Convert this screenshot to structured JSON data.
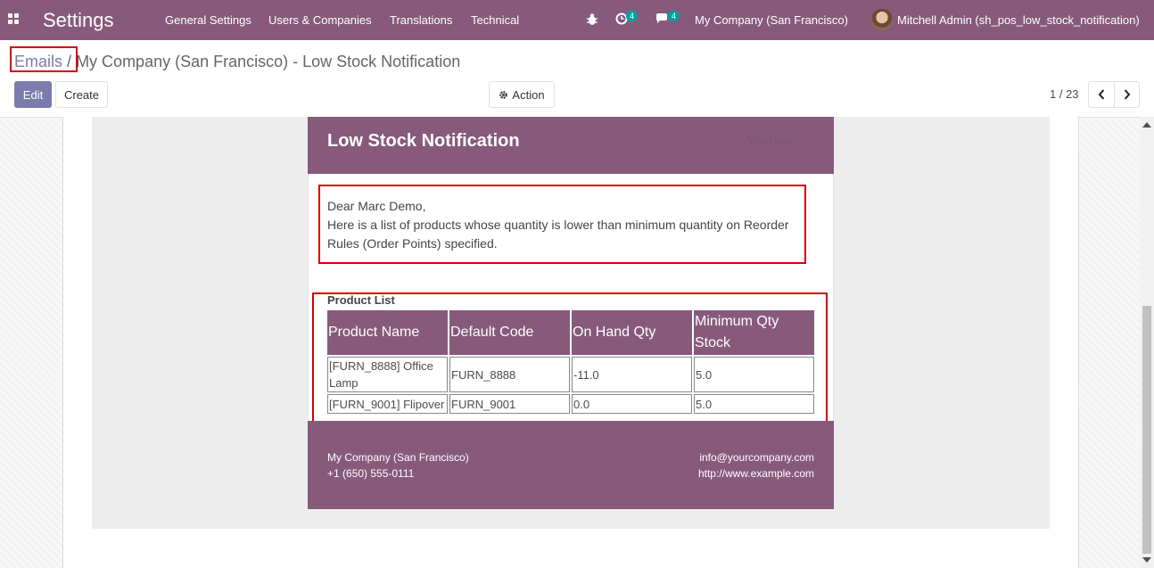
{
  "navbar": {
    "app_title": "Settings",
    "menu": [
      "General Settings",
      "Users & Companies",
      "Translations",
      "Technical"
    ],
    "activity_count": "4",
    "messages_count": "4",
    "company": "My Company (San Francisco)",
    "user": "Mitchell Admin (sh_pos_low_stock_notification)",
    "brand_color": "#875a7b"
  },
  "breadcrumb": {
    "parent": "Emails",
    "separator": "/",
    "current": "My Company (San Francisco) - Low Stock Notification"
  },
  "toolbar": {
    "edit_label": "Edit",
    "create_label": "Create",
    "action_label": "Action",
    "pager": "1 / 23"
  },
  "email": {
    "title": "Low Stock Notification",
    "logo_text": "YourLogo",
    "greeting": "Dear Marc Demo,",
    "message": "Here is a list of products whose quantity is lower than minimum quantity on Reorder Rules (Order Points) specified.",
    "list_title": "Product List",
    "columns": [
      "Product Name",
      "Default Code",
      "On Hand Qty",
      "Minimum Qty Stock"
    ],
    "rows": [
      {
        "name": "[FURN_8888] Office Lamp",
        "code": "FURN_8888",
        "on_hand": "-11.0",
        "min_qty": "5.0"
      },
      {
        "name": "[FURN_9001] Flipover",
        "code": "FURN_9001",
        "on_hand": "0.0",
        "min_qty": "5.0"
      }
    ],
    "footer": {
      "company": "My Company (San Francisco)",
      "phone": "+1 (650) 555-0111",
      "email": "info@yourcompany.com",
      "website": "http://www.example.com"
    }
  }
}
